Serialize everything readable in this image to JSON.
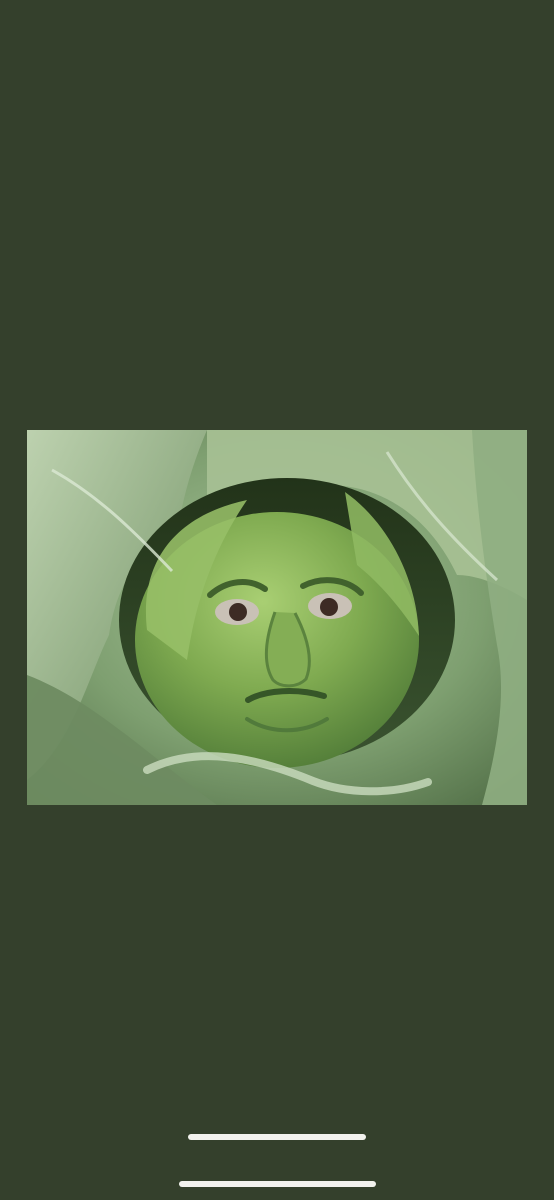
{
  "screen": {
    "background_color": "#34402c"
  },
  "photo": {
    "subject": "cabbage-head-with-face",
    "dominant_colors": [
      "#7aa06b",
      "#5f8552",
      "#b8cfaa",
      "#2f3f24"
    ]
  },
  "system_ui": {
    "home_indicator_color": "#f2f2ee"
  }
}
